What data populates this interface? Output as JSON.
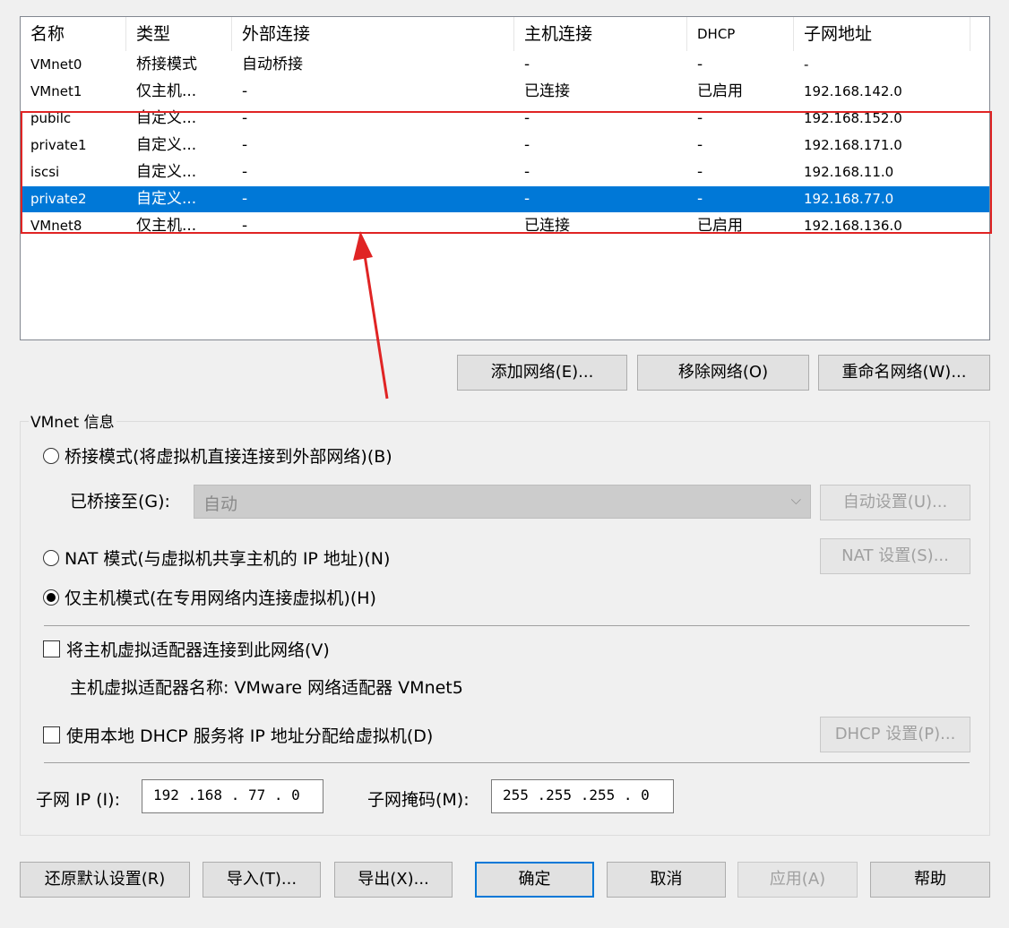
{
  "columns": [
    "名称",
    "类型",
    "外部连接",
    "主机连接",
    "DHCP",
    "子网地址"
  ],
  "rows": [
    {
      "name": "VMnet0",
      "type": "桥接模式",
      "ext": "自动桥接",
      "host": "-",
      "dhcp": "-",
      "subnet": "-"
    },
    {
      "name": "VMnet1",
      "type": "仅主机...",
      "ext": "-",
      "host": "已连接",
      "dhcp": "已启用",
      "subnet": "192.168.142.0"
    },
    {
      "name": "pubilc",
      "type": "自定义...",
      "ext": "-",
      "host": "-",
      "dhcp": "-",
      "subnet": "192.168.152.0"
    },
    {
      "name": "private1",
      "type": "自定义...",
      "ext": "-",
      "host": "-",
      "dhcp": "-",
      "subnet": "192.168.171.0"
    },
    {
      "name": "iscsi",
      "type": "自定义...",
      "ext": "-",
      "host": "-",
      "dhcp": "-",
      "subnet": "192.168.11.0"
    },
    {
      "name": "private2",
      "type": "自定义...",
      "ext": "-",
      "host": "-",
      "dhcp": "-",
      "subnet": "192.168.77.0"
    },
    {
      "name": "VMnet8",
      "type": "仅主机...",
      "ext": "-",
      "host": "已连接",
      "dhcp": "已启用",
      "subnet": "192.168.136.0"
    }
  ],
  "selected_row": "private2",
  "list_buttons": {
    "add": "添加网络(E)...",
    "remove": "移除网络(O)",
    "rename": "重命名网络(W)..."
  },
  "info": {
    "legend": "VMnet 信息",
    "bridge_label": "桥接模式(将虚拟机直接连接到外部网络)(B)",
    "bridged_to_label": "已桥接至(G):",
    "bridged_to_value": "自动",
    "auto_settings": "自动设置(U)...",
    "nat_label": "NAT 模式(与虚拟机共享主机的 IP 地址)(N)",
    "nat_settings": "NAT 设置(S)...",
    "hostonly_label": "仅主机模式(在专用网络内连接虚拟机)(H)",
    "selected_mode": "host-only",
    "adapter_label": "将主机虚拟适配器连接到此网络(V)",
    "adapter_name": "主机虚拟适配器名称: VMware 网络适配器 VMnet5",
    "dhcp_label": "使用本地 DHCP 服务将 IP 地址分配给虚拟机(D)",
    "dhcp_settings": "DHCP 设置(P)...",
    "subnet_ip_label": "子网 IP (I):",
    "subnet_ip": "192 .168 . 77  .  0",
    "subnet_mask_label": "子网掩码(M):",
    "subnet_mask": "255 .255 .255 .  0"
  },
  "bottom_buttons": {
    "restore": "还原默认设置(R)",
    "import": "导入(T)...",
    "export": "导出(X)...",
    "ok": "确定",
    "cancel": "取消",
    "apply": "应用(A)",
    "help": "帮助"
  },
  "colors": {
    "selection": "#0078d7",
    "annotation": "#e02424"
  }
}
